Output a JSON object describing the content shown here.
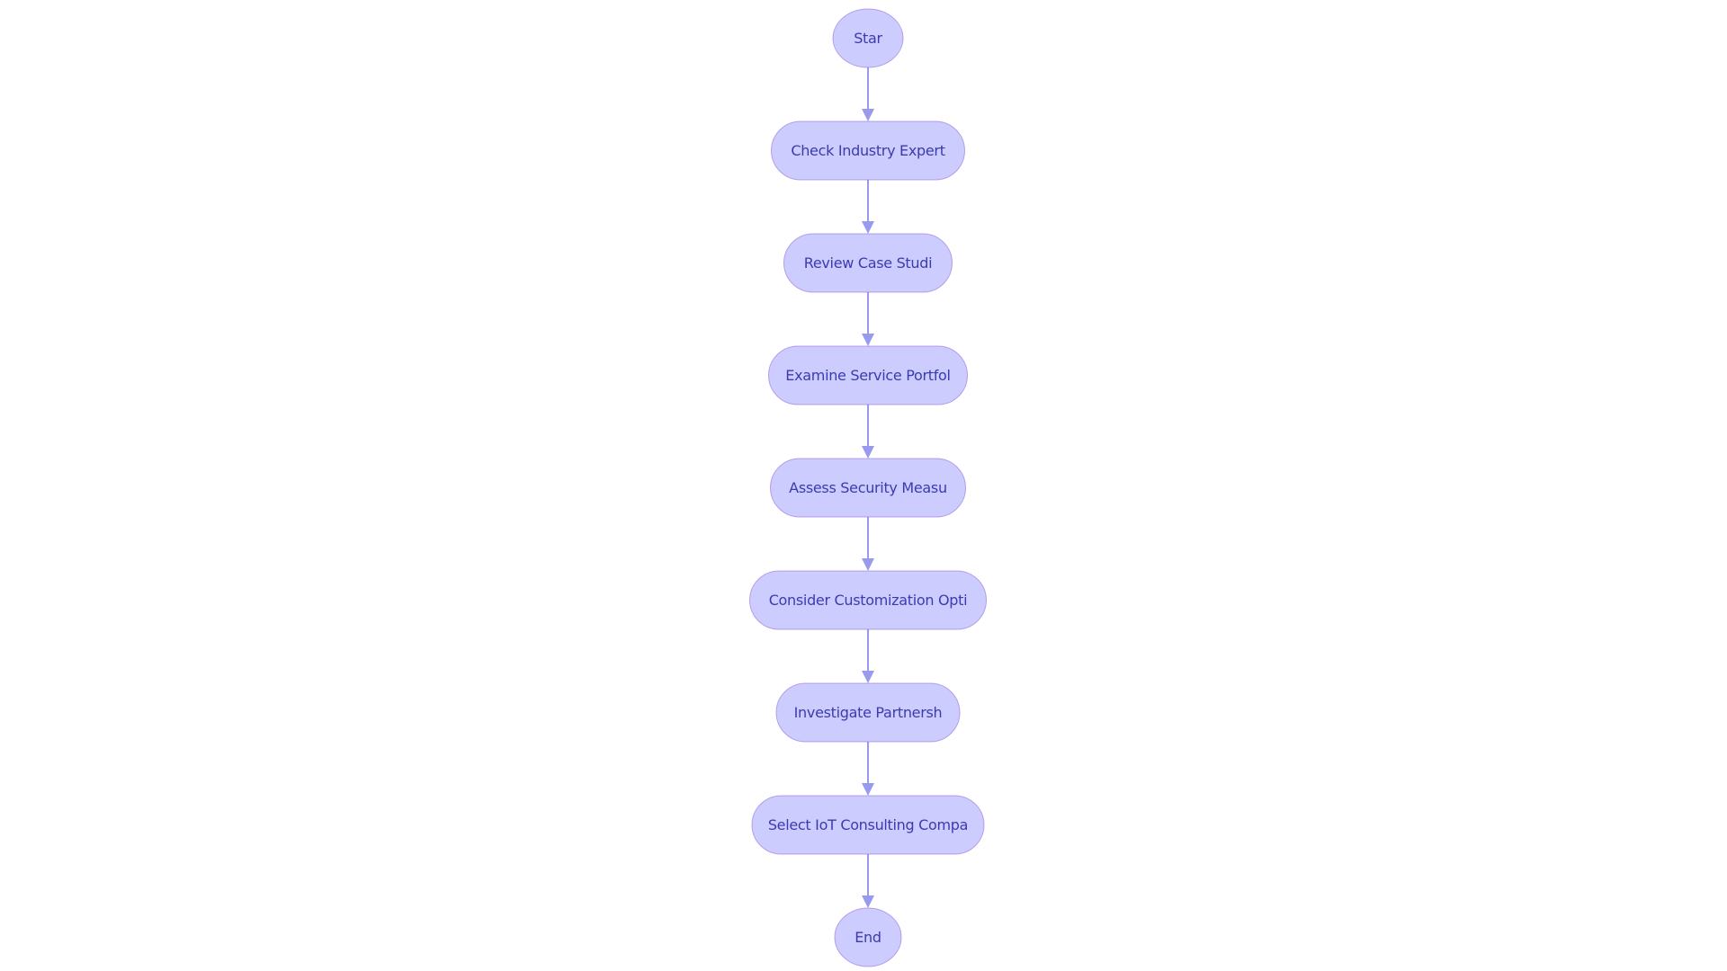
{
  "diagram": {
    "type": "flowchart",
    "direction": "top-to-bottom",
    "colors": {
      "node_fill": "#CCCCFF",
      "node_stroke": "#9370DB",
      "label": "#3b3bb0",
      "edge": "#9999EE"
    },
    "nodes": [
      {
        "id": "start",
        "label": "Star",
        "shape": "circle"
      },
      {
        "id": "check",
        "label": "Check Industry Expert",
        "shape": "stadium"
      },
      {
        "id": "review",
        "label": "Review Case Studi",
        "shape": "stadium"
      },
      {
        "id": "examine",
        "label": "Examine Service Portfol",
        "shape": "stadium"
      },
      {
        "id": "assess",
        "label": "Assess Security Measu",
        "shape": "stadium"
      },
      {
        "id": "consider",
        "label": "Consider Customization Opti",
        "shape": "stadium"
      },
      {
        "id": "investigate",
        "label": "Investigate Partnersh",
        "shape": "stadium"
      },
      {
        "id": "select",
        "label": "Select IoT Consulting Compa",
        "shape": "stadium"
      },
      {
        "id": "end",
        "label": "End",
        "shape": "circle"
      }
    ],
    "edges": [
      {
        "from": "start",
        "to": "check"
      },
      {
        "from": "check",
        "to": "review"
      },
      {
        "from": "review",
        "to": "examine"
      },
      {
        "from": "examine",
        "to": "assess"
      },
      {
        "from": "assess",
        "to": "consider"
      },
      {
        "from": "consider",
        "to": "investigate"
      },
      {
        "from": "investigate",
        "to": "select"
      },
      {
        "from": "select",
        "to": "end"
      }
    ]
  }
}
